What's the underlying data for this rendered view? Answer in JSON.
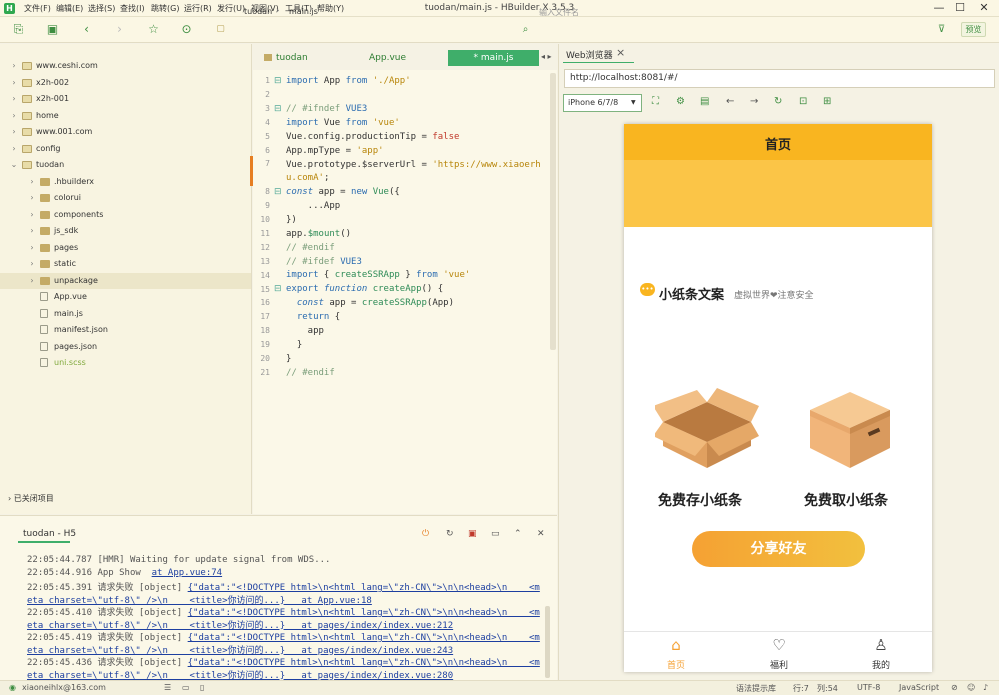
{
  "window": {
    "title": "tuodan/main.js - HBuilder X 3.5.3",
    "logo": "H",
    "menu": [
      "文件(F)",
      "编辑(E)",
      "选择(S)",
      "查找(I)",
      "跳转(G)",
      "运行(R)",
      "发行(U)",
      "视图(V)",
      "工具(T)",
      "帮助(Y)"
    ]
  },
  "toolbar": {
    "breadcrumb_file": "tuodan",
    "breadcrumb_sep": "›",
    "breadcrumb_main": "main.js",
    "file_search_placeholder": "输入文件名",
    "preview_label": "预览"
  },
  "sidebar": {
    "items": [
      {
        "label": "www.ceshi.com",
        "arrow": "›",
        "type": "root"
      },
      {
        "label": "x2h-002",
        "arrow": "›",
        "type": "root"
      },
      {
        "label": "x2h-001",
        "arrow": "›",
        "type": "root"
      },
      {
        "label": "home",
        "arrow": "›",
        "type": "root"
      },
      {
        "label": "www.001.com",
        "arrow": "›",
        "type": "root"
      },
      {
        "label": "config",
        "arrow": "›",
        "type": "root"
      },
      {
        "label": "tuodan",
        "arrow": "⌄",
        "type": "root"
      },
      {
        "label": ".hbuilderx",
        "arrow": "›",
        "type": "folder"
      },
      {
        "label": "colorui",
        "arrow": "›",
        "type": "folder"
      },
      {
        "label": "components",
        "arrow": "›",
        "type": "folder"
      },
      {
        "label": "js_sdk",
        "arrow": "›",
        "type": "folder"
      },
      {
        "label": "pages",
        "arrow": "›",
        "type": "folder"
      },
      {
        "label": "static",
        "arrow": "›",
        "type": "folder"
      },
      {
        "label": "unpackage",
        "arrow": "›",
        "type": "folder"
      },
      {
        "label": "App.vue",
        "arrow": "",
        "type": "file"
      },
      {
        "label": "main.js",
        "arrow": "",
        "type": "file"
      },
      {
        "label": "manifest.json",
        "arrow": "",
        "type": "file"
      },
      {
        "label": "pages.json",
        "arrow": "",
        "type": "file"
      },
      {
        "label": "uni.scss",
        "arrow": "",
        "type": "file"
      }
    ],
    "closed_projects": "已关闭项目"
  },
  "editor": {
    "tabs": {
      "project": "tuodan",
      "app": "App.vue",
      "main": "* main.js",
      "scroll": "◂ ▸"
    },
    "line_numbers": [
      "1",
      "2",
      "3",
      "4",
      "5",
      "6",
      "7",
      "",
      "8",
      "9",
      "10",
      "11",
      "12",
      "13",
      "14",
      "15",
      "16",
      "17",
      "18",
      "19",
      "20",
      "21"
    ]
  },
  "console": {
    "tab_label": "tuodan - H5",
    "lines": [
      {
        "time": "22:05:44.787",
        "text": "[HMR] Waiting for update signal from WDS...",
        "link": ""
      },
      {
        "time": "22:05:44.916",
        "text": "App Show  ",
        "link": "at App.vue:74"
      },
      {
        "time": "22:05:45.391",
        "text": "请求失败 [object] ",
        "link": "{\"data\":\"<!DOCTYPE html>\\n<html lang=\\\"zh-CN\\\">\\n\\n<head>\\n    <m"
      },
      {
        "time": "",
        "text": "",
        "link": "eta charset=\\\"utf-8\\\" />\\n    <title>你访问的...}   at App.vue:18"
      },
      {
        "time": "22:05:45.410",
        "text": "请求失败 [object] ",
        "link": "{\"data\":\"<!DOCTYPE html>\\n<html lang=\\\"zh-CN\\\">\\n\\n<head>\\n    <m"
      },
      {
        "time": "",
        "text": "",
        "link": "eta charset=\\\"utf-8\\\" />\\n    <title>你访问的...}   at pages/index/index.vue:212"
      },
      {
        "time": "22:05:45.419",
        "text": "请求失败 [object] ",
        "link": "{\"data\":\"<!DOCTYPE html>\\n<html lang=\\\"zh-CN\\\">\\n\\n<head>\\n    <m"
      },
      {
        "time": "",
        "text": "",
        "link": "eta charset=\\\"utf-8\\\" />\\n    <title>你访问的...}   at pages/index/index.vue:243"
      },
      {
        "time": "22:05:45.436",
        "text": "请求失败 [object] ",
        "link": "{\"data\":\"<!DOCTYPE html>\\n<html lang=\\\"zh-CN\\\">\\n\\n<head>\\n    <m"
      },
      {
        "time": "",
        "text": "",
        "link": "eta charset=\\\"utf-8\\\" />\\n    <title>你访问的...}   at pages/index/index.vue:280"
      }
    ]
  },
  "statusbar": {
    "user": "xiaoneihlx@163.com",
    "hint": "语法提示库",
    "line": "行:7",
    "col": "列:54",
    "encoding": "UTF-8",
    "language": "JavaScript"
  },
  "browser": {
    "tab_label": "Web浏览器",
    "close": "×",
    "url": "http://localhost:8081/#/",
    "device": "iPhone 6/7/8"
  },
  "phone": {
    "nav_title": "首页",
    "brand_title": "小纸条文案",
    "brand_sub": "虚拟世界❤注意安全",
    "store_label": "免费存小纸条",
    "take_label": "免费取小纸条",
    "share_label": "分享好友",
    "tabs": [
      {
        "label": "首页",
        "icon": "home-icon",
        "active": true
      },
      {
        "label": "福利",
        "icon": "heart-icon",
        "active": false
      },
      {
        "label": "我的",
        "icon": "user-icon",
        "active": false
      }
    ],
    "accent": "#f9b520",
    "active_tab_color": "#f5a133"
  }
}
